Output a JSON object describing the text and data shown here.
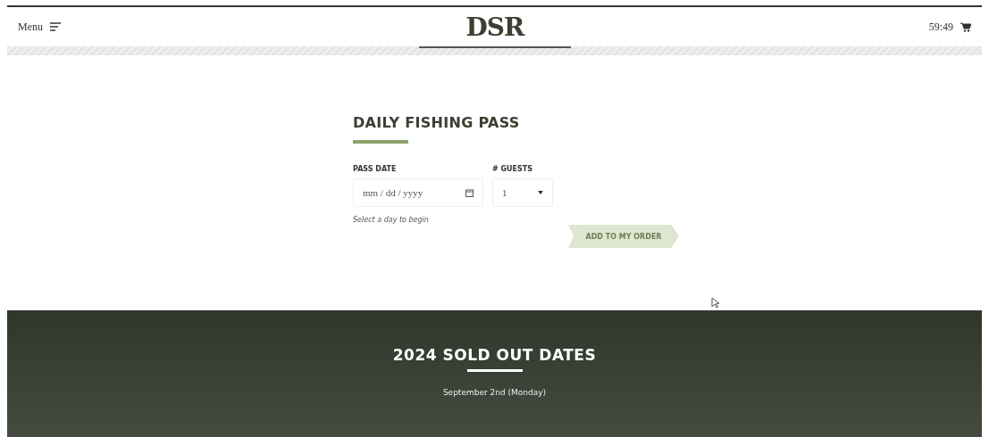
{
  "header": {
    "menu_label": "Menu",
    "logo": "DSR",
    "timer": "59:49"
  },
  "form": {
    "title": "DAILY FISHING PASS",
    "fields": [
      {
        "kind": "date",
        "label": "PASS DATE",
        "placeholder": "mm / dd / yyyy"
      },
      {
        "kind": "select",
        "label": "# GUESTS",
        "value": "1"
      }
    ],
    "hint": "Select a day to begin",
    "button": {
      "label": "ADD TO MY ORDER",
      "disabled": true
    }
  },
  "sold_out": {
    "title": "2024 SOLD OUT DATES",
    "dates": [
      "September 2nd (Monday)"
    ]
  }
}
